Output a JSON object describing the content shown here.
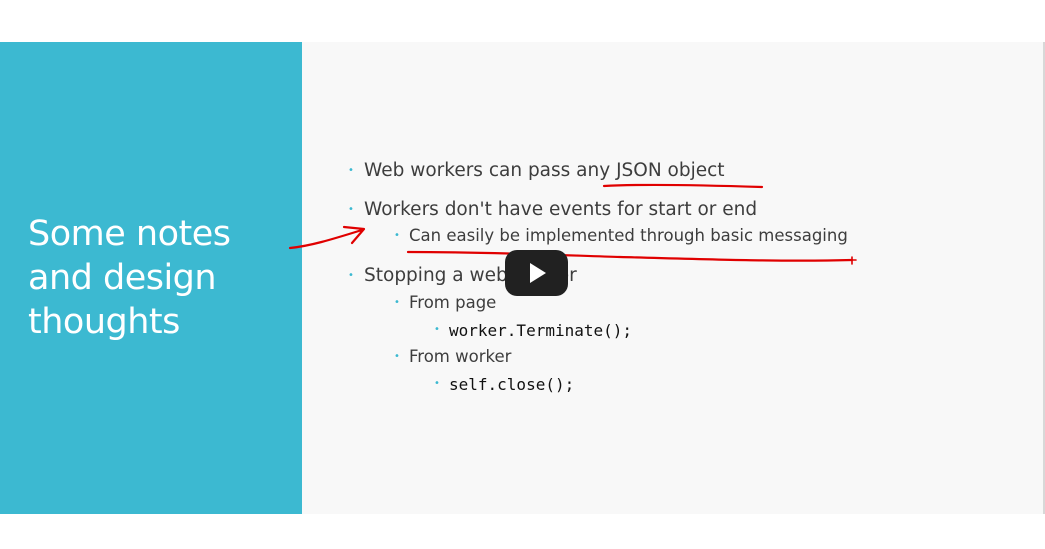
{
  "slide": {
    "title": "Some notes\nand design\nthoughts",
    "bullets": {
      "b1": "Web workers can pass any JSON object",
      "b2": "Workers don't have events for start or end",
      "b2_1": "Can easily be implemented through basic messaging",
      "b3": "Stopping a web worker",
      "b3_1": "From page",
      "b3_1_1": "worker.Terminate();",
      "b3_2": "From worker",
      "b3_2_1": "self.close();"
    },
    "bullet_glyph": "•"
  },
  "player": {
    "play_icon": "play-icon"
  },
  "colors": {
    "accent": "#3cb9d1",
    "ink": "#e00000",
    "text": "#3d3d3d",
    "play_bg": "#212121"
  }
}
